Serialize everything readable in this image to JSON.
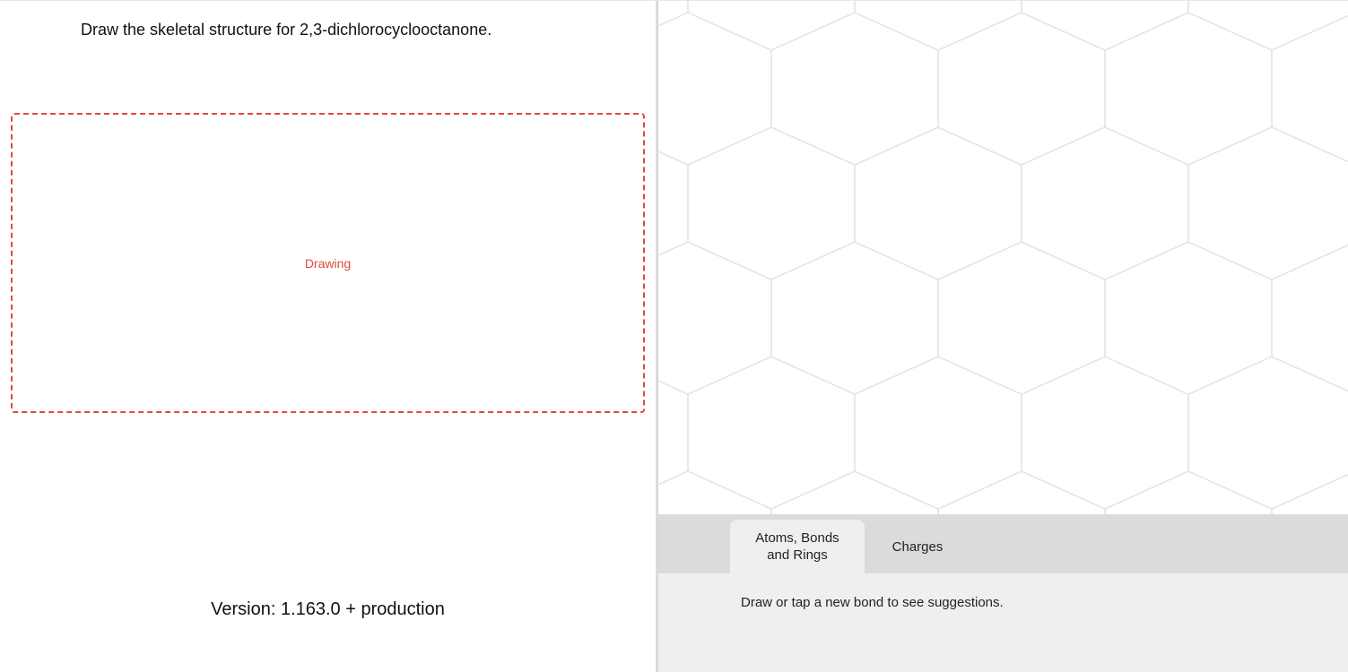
{
  "question": {
    "prompt": "Draw the skeletal structure for 2,3-dichlorocyclooctanone."
  },
  "dropzone": {
    "label": "Drawing"
  },
  "footer": {
    "version_line": "Version: 1.163.0 +  production"
  },
  "editor": {
    "tabs": {
      "atoms_bonds_rings": "Atoms, Bonds and Rings",
      "charges": "Charges"
    },
    "hint": "Draw or tap a new bond to see suggestions."
  }
}
